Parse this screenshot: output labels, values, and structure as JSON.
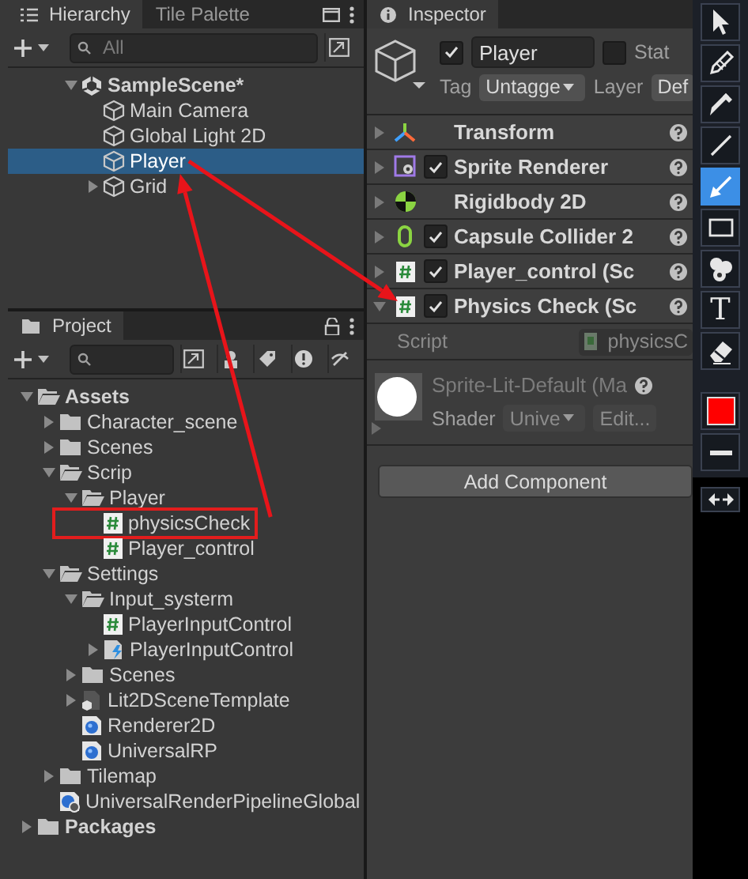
{
  "hierarchy": {
    "tabs": [
      {
        "label": "Hierarchy",
        "selected": true
      },
      {
        "label": "Tile Palette",
        "selected": false
      }
    ],
    "search": {
      "placeholder": "All"
    },
    "tree": [
      {
        "kind": "scene",
        "label": "SampleScene*",
        "expanded": true,
        "selected": false,
        "children": [
          {
            "kind": "gameobject",
            "label": "Main Camera",
            "selected": false
          },
          {
            "kind": "gameobject",
            "label": "Global Light 2D",
            "selected": false
          },
          {
            "kind": "gameobject",
            "label": "Player",
            "selected": true
          },
          {
            "kind": "gameobject",
            "label": "Grid",
            "expanded": false,
            "selected": false
          }
        ]
      }
    ]
  },
  "project": {
    "tabs": [
      {
        "label": "Project",
        "selected": true
      }
    ],
    "tree": [
      {
        "kind": "folder",
        "label": "Assets",
        "expanded": true,
        "selected": false,
        "children": [
          {
            "kind": "folder",
            "label": "Character_scene",
            "expanded": false,
            "selected": false
          },
          {
            "kind": "folder",
            "label": "Scenes",
            "expanded": false,
            "selected": false
          },
          {
            "kind": "folder",
            "label": "Scrip",
            "expanded": true,
            "selected": false,
            "children": [
              {
                "kind": "folder",
                "label": "Player",
                "expanded": true,
                "selected": false,
                "children": [
                  {
                    "kind": "script",
                    "label": "physicsCheck",
                    "selected": false,
                    "highlighted": true
                  },
                  {
                    "kind": "script",
                    "label": "Player_control",
                    "selected": false
                  }
                ]
              }
            ]
          },
          {
            "kind": "folder",
            "label": "Settings",
            "expanded": true,
            "selected": false,
            "children": [
              {
                "kind": "folder",
                "label": "Input_systerm",
                "expanded": true,
                "selected": false,
                "children": [
                  {
                    "kind": "script",
                    "label": "PlayerInputControl",
                    "selected": false
                  },
                  {
                    "kind": "input_actions",
                    "label": "PlayerInputControl",
                    "expanded": false,
                    "selected": false
                  }
                ]
              },
              {
                "kind": "folder",
                "label": "Scenes",
                "expanded": false,
                "selected": false
              },
              {
                "kind": "scene_template",
                "label": "Lit2DSceneTemplate",
                "expanded": false,
                "selected": false
              },
              {
                "kind": "render_asset",
                "label": "Renderer2D",
                "selected": false
              },
              {
                "kind": "render_asset",
                "label": "UniversalRP",
                "selected": false
              }
            ]
          },
          {
            "kind": "folder",
            "label": "Tilemap",
            "expanded": false,
            "selected": false
          },
          {
            "kind": "render_settings",
            "label": "UniversalRenderPipelineGlobal",
            "selected": false
          }
        ]
      },
      {
        "kind": "folder",
        "label": "Packages",
        "expanded": false,
        "selected": false
      }
    ]
  },
  "inspector": {
    "tab": {
      "label": "Inspector"
    },
    "object": {
      "active": true,
      "name": "Player",
      "static": false,
      "static_label": "Stat",
      "tag_label": "Tag",
      "tag": "Untagge",
      "layer_label": "Layer",
      "layer": "Def"
    },
    "components": [
      {
        "kind": "transform",
        "name": "Transform",
        "expanded": false
      },
      {
        "kind": "sprite_renderer",
        "name": "Sprite Renderer",
        "enabled": true,
        "expanded": false
      },
      {
        "kind": "rigidbody",
        "name": "Rigidbody 2D",
        "expanded": false
      },
      {
        "kind": "collider",
        "name": "Capsule Collider 2",
        "enabled": true,
        "expanded": false
      },
      {
        "kind": "script",
        "name": "Player_control (Sc",
        "enabled": true,
        "expanded": false
      },
      {
        "kind": "script",
        "name": "Physics Check (Sc",
        "enabled": true,
        "expanded": true,
        "fields": [
          {
            "label": "Script",
            "value": "physicsC"
          }
        ]
      }
    ],
    "material": {
      "name": "Sprite-Lit-Default (Ma",
      "shader_label": "Shader",
      "shader": "Unive",
      "edit": "Edit...",
      "expanded": false
    },
    "add_component": "Add Component"
  },
  "toolbar": {
    "tools": [
      {
        "kind": "select",
        "selected": false
      },
      {
        "kind": "pencil",
        "selected": false
      },
      {
        "kind": "marker",
        "selected": false
      },
      {
        "kind": "line",
        "selected": false
      },
      {
        "kind": "arrow",
        "selected": true
      },
      {
        "kind": "rectangle",
        "selected": false
      },
      {
        "kind": "number",
        "selected": false
      },
      {
        "kind": "text",
        "glyph": "T",
        "selected": false
      },
      {
        "kind": "eraser",
        "selected": false
      }
    ],
    "color": "#ff0000",
    "width_tool": {
      "kind": "width"
    },
    "expand": {
      "kind": "expand"
    }
  }
}
